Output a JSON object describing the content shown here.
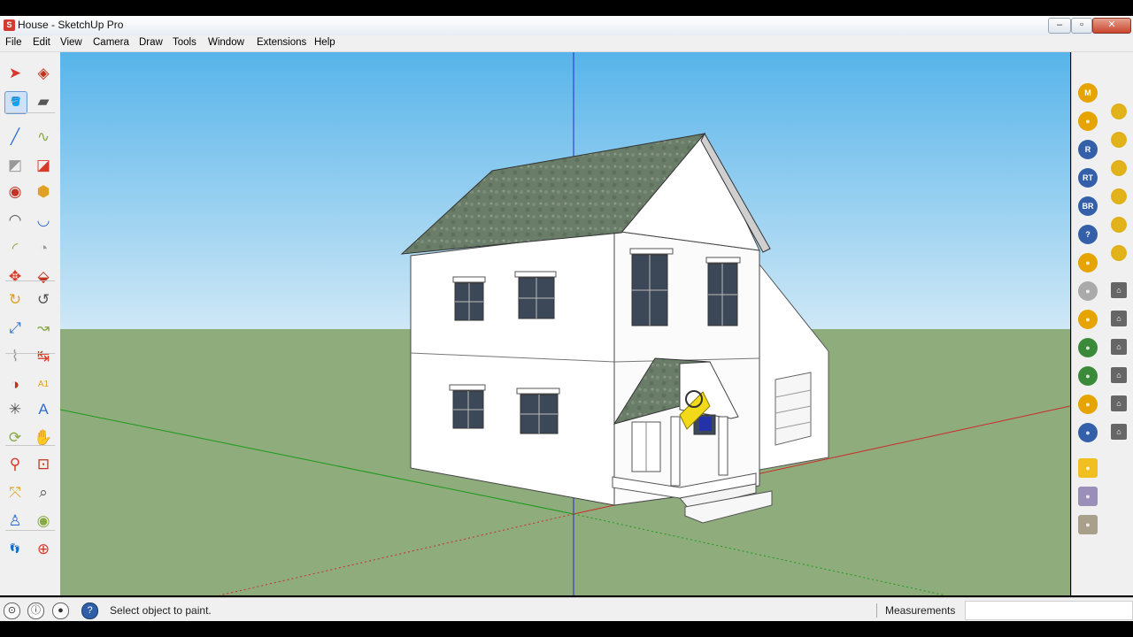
{
  "window": {
    "title": "House - SketchUp Pro",
    "logo": "S",
    "controls": [
      "–",
      "▫",
      "✕"
    ]
  },
  "menu": [
    "File",
    "Edit",
    "View",
    "Camera",
    "Draw",
    "Tools",
    "Window",
    "Extensions",
    "Help"
  ],
  "left_tools": [
    "select-tool-icon",
    "component-tool-icon",
    "paint-bucket-tool-icon",
    "eraser-tool-icon",
    "line-tool-icon",
    "freehand-tool-icon",
    "rectangle-tool-icon",
    "rotated-rectangle-tool-icon",
    "circle-tool-icon",
    "polygon-tool-icon",
    "arc-tool-icon",
    "two-point-arc-tool-icon",
    "three-point-arc-tool-icon",
    "pie-tool-icon",
    "move-tool-icon",
    "push-pull-tool-icon",
    "rotate-tool-icon",
    "follow-me-tool-icon",
    "scale-tool-icon",
    "offset-tool-icon",
    "tape-measure-tool-icon",
    "dimension-tool-icon",
    "protractor-tool-icon",
    "text-tool-icon",
    "axes-tool-icon",
    "3d-text-tool-icon",
    "orbit-tool-icon",
    "pan-tool-icon",
    "zoom-tool-icon",
    "zoom-window-tool-icon",
    "zoom-extents-tool-icon",
    "previous-view-icon",
    "position-camera-icon",
    "look-around-icon",
    "walk-tool-icon",
    "section-plane-tool-icon"
  ],
  "text_tool_label": "A1",
  "right_tools": [
    {
      "label": "M",
      "color": "#e6a400"
    },
    {
      "label": "",
      "color": "#e6a400"
    },
    {
      "label": "R",
      "color": "#3360a8"
    },
    {
      "label": "RT",
      "color": "#3360a8"
    },
    {
      "label": "BR",
      "color": "#3360a8"
    },
    {
      "label": "?",
      "color": "#3360a8"
    },
    {
      "label": "",
      "color": "#e6a400"
    },
    {
      "label": "",
      "color": "#aaaaaa"
    },
    {
      "label": "",
      "color": "#e6a400"
    },
    {
      "label": "",
      "color": "#3a8a3a"
    },
    {
      "label": "",
      "color": "#3a8a3a"
    },
    {
      "label": "",
      "color": "#e6a400"
    },
    {
      "label": "",
      "color": "#3360a8"
    },
    {
      "label": "",
      "color": "#f0c020"
    },
    {
      "label": "",
      "color": "#9a8fb8"
    },
    {
      "label": "",
      "color": "#a8a08a"
    }
  ],
  "status": {
    "message": "Select object to paint.",
    "measurements_label": "Measurements",
    "measurements_value": ""
  },
  "colors": {
    "sky_top": "#57b4ea",
    "sky_bottom": "#cfe8f6",
    "ground": "#8fac7c",
    "wall": "#ffffff",
    "roof": "#667a66",
    "window_glass": "#3c4858",
    "axis_red": "#cc2a2a",
    "axis_green": "#1a9a1a",
    "axis_blue": "#2a2acc"
  }
}
